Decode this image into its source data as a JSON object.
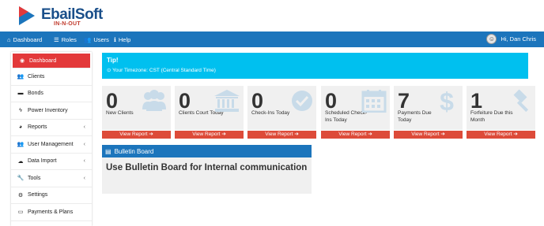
{
  "brand": {
    "name": "EbailSoft",
    "tagline": "IN-N-OUT"
  },
  "nav": {
    "items": [
      {
        "label": "Dashboard",
        "icon": "home-icon"
      },
      {
        "label": "Roles",
        "icon": "list-icon"
      },
      {
        "label": "Users",
        "icon": "users-icon"
      },
      {
        "label": "Help",
        "icon": "info-icon"
      }
    ],
    "user_greeting": "Hi, Dan Chris"
  },
  "sidebar": {
    "items": [
      {
        "label": "Dashboard",
        "icon": "dashboard-icon",
        "active": true
      },
      {
        "label": "Clients",
        "icon": "clients-icon"
      },
      {
        "label": "Bonds",
        "icon": "folder-icon"
      },
      {
        "label": "Power Inventory",
        "icon": "bolt-icon"
      },
      {
        "label": "Reports",
        "icon": "pie-chart-icon",
        "expandable": true
      },
      {
        "label": "User Management",
        "icon": "users-icon",
        "expandable": true
      },
      {
        "label": "Data Import",
        "icon": "upload-cloud-icon",
        "expandable": true
      },
      {
        "label": "Tools",
        "icon": "wrench-icon",
        "expandable": true
      },
      {
        "label": "Settings",
        "icon": "gear-icon"
      },
      {
        "label": "Payments & Plans",
        "icon": "credit-card-icon"
      }
    ]
  },
  "tip": {
    "title": "Tip!",
    "text": "Your Timezone: CST (Central Standard Time)"
  },
  "stats": [
    {
      "value": "0",
      "label": "New Clients",
      "button": "View Report",
      "icon": "users-icon"
    },
    {
      "value": "0",
      "label": "Clients Court Today",
      "button": "View Report",
      "icon": "courthouse-icon"
    },
    {
      "value": "0",
      "label": "Check-Ins Today",
      "button": "View Report",
      "icon": "check-circle-icon"
    },
    {
      "value": "0",
      "label": "Scheduled Check-Ins Today",
      "button": "View Report",
      "icon": "calendar-icon"
    },
    {
      "value": "7",
      "label": "Payments Due Today",
      "button": "View Report",
      "icon": "dollar-icon"
    },
    {
      "value": "1",
      "label": "Forfeiture Due this Month",
      "button": "View Report",
      "icon": "gavel-icon"
    }
  ],
  "bulletin": {
    "title": "Bulletin Board",
    "message": "Use Bulletin Board for Internal communication"
  },
  "colors": {
    "primary": "#1c75bc",
    "active": "#e3393a",
    "tip": "#00c0ef",
    "button": "#dd4b39",
    "icon": "#c8dbe9"
  }
}
